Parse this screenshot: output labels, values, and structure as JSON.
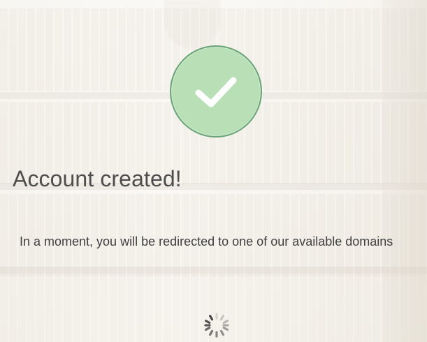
{
  "status": {
    "title": "Account created!",
    "message": "In a moment, you will be redirected to one of our available domains"
  },
  "icons": {
    "success": "check-icon",
    "loading": "spinner-icon"
  },
  "colors": {
    "success_fill": "#b9dfb7",
    "success_border": "#6aa476",
    "text_primary": "#4d4d4d",
    "text_body": "#3f3f3f"
  }
}
